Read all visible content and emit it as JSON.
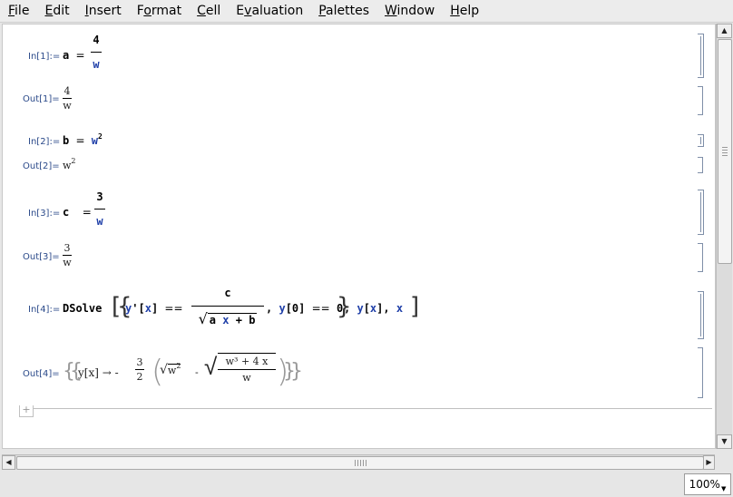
{
  "menu": [
    "File",
    "Edit",
    "Insert",
    "Format",
    "Cell",
    "Evaluation",
    "Palettes",
    "Window",
    "Help"
  ],
  "menu_accel": [
    "F",
    "E",
    "I",
    "o",
    "C",
    "v",
    "P",
    "W",
    "H"
  ],
  "cells": {
    "in1_label": "In[1]:=",
    "in1_lhs": "a",
    "in1_eq": "=",
    "in1_num": "4",
    "in1_den": "w",
    "out1_label": "Out[1]=",
    "out1_num": "4",
    "out1_den": "w",
    "in2_label": "In[2]:=",
    "in2_lhs": "b",
    "in2_eq": "=",
    "in2_base": "w",
    "in2_exp": "2",
    "out2_label": "Out[2]=",
    "out2_base": "w",
    "out2_exp": "2",
    "in3_label": "In[3]:=",
    "in3_lhs": "c",
    "in3_eq": "=",
    "in3_num": "3",
    "in3_den": "w",
    "out3_label": "Out[3]=",
    "out3_num": "3",
    "out3_den": "w",
    "in4_label": "In[4]:=",
    "in4_func": "DSolve",
    "in4_y1": "y",
    "in4_prime": "'",
    "in4_x1": "x",
    "in4_eqeq": "==",
    "in4_num": "c",
    "in4_rad_a": "a",
    "in4_rad_x": "x",
    "in4_rad_plus": "+",
    "in4_rad_b": "b",
    "in4_y2": "y",
    "in4_zero_arg": "0",
    "in4_eqeq2": "==",
    "in4_zero_val": "0",
    "in4_y3": "y",
    "in4_x3": "x",
    "in4_x4": "x",
    "out4_label": "Out[4]=",
    "out4_y": "y",
    "out4_x": "x",
    "out4_arrow": "→",
    "out4_minus": "-",
    "out4_num": "3",
    "out4_den": "2",
    "out4_w": "w",
    "out4_w_exp": "2",
    "out4_minus2": "-",
    "out4_inner_num": "w³ + 4 x",
    "out4_inner_den": "w"
  },
  "zoom": "100%",
  "colors": {
    "symbol_blue": "#1f3fa8",
    "label": "#2b4a8a",
    "bracket": "#7f8fa8"
  }
}
